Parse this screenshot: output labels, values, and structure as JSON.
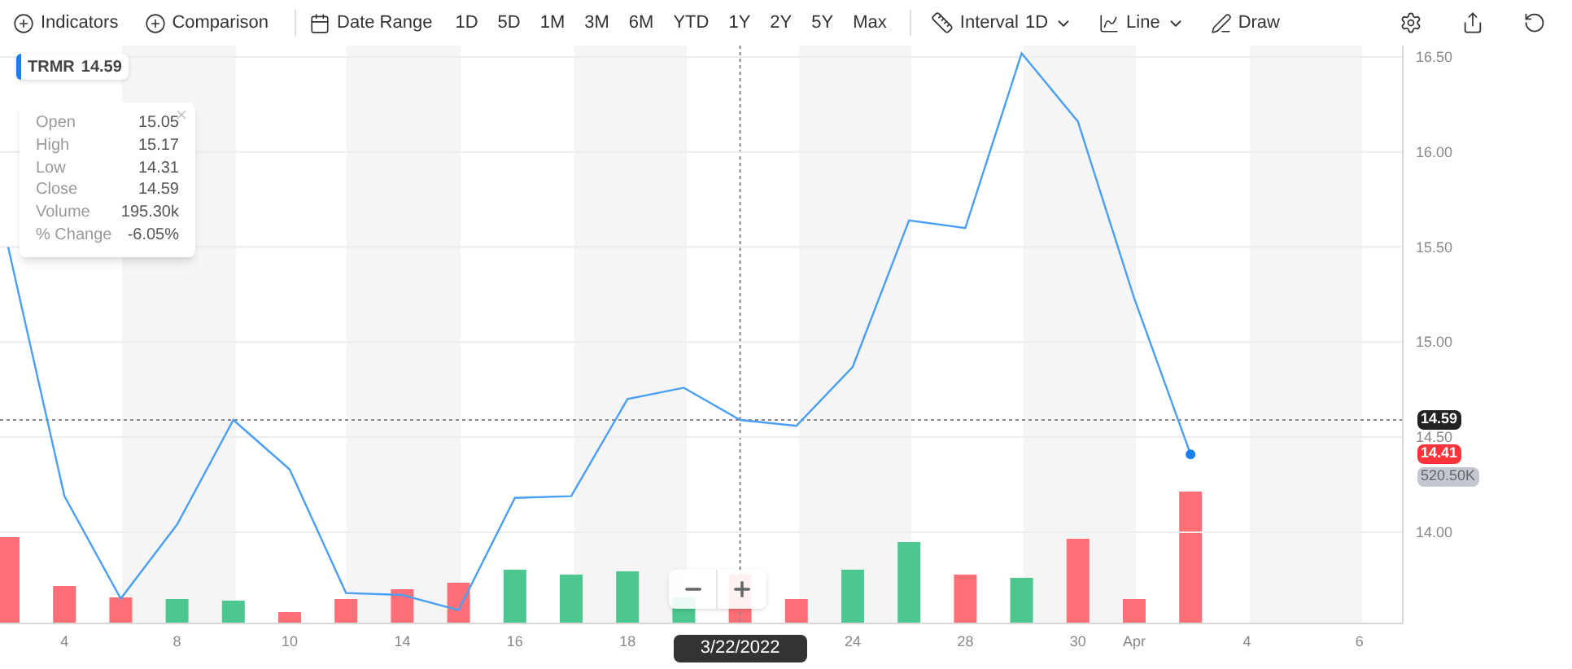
{
  "toolbar": {
    "add_buttons": [
      {
        "label": "Indicators"
      },
      {
        "label": "Comparison"
      }
    ],
    "date_range": {
      "label": "Date Range",
      "ranges": [
        "1D",
        "5D",
        "1M",
        "3M",
        "6M",
        "YTD",
        "1Y",
        "2Y",
        "5Y",
        "Max"
      ]
    },
    "interval": {
      "label": "Interval",
      "value": "1D"
    },
    "chart_type": {
      "label": "Line"
    },
    "draw": {
      "label": "Draw"
    }
  },
  "legend": {
    "price": "14.59"
  },
  "tooltip": {
    "rows": [
      {
        "label": "Open",
        "value": "15.05"
      },
      {
        "label": "High",
        "value": "15.17"
      },
      {
        "label": "Low",
        "value": "14.31"
      },
      {
        "label": "Close",
        "value": "14.59"
      },
      {
        "label": "Volume",
        "value": "195.30k"
      },
      {
        "label": "% Change",
        "value": "-6.05%"
      }
    ]
  },
  "chart_data": {
    "type": "line",
    "categories": [
      null,
      "4",
      null,
      "8",
      null,
      "10",
      null,
      "14",
      null,
      "16",
      null,
      "18",
      null,
      null,
      null,
      "24",
      null,
      "28",
      null,
      "30",
      "Apr",
      null,
      "4",
      null,
      "6"
    ],
    "series": [
      {
        "name": "TRMR",
        "color": "#4a9ff5",
        "values": [
          15.5,
          14.19,
          13.65,
          14.04,
          14.59,
          14.33,
          13.68,
          13.67,
          13.59,
          14.18,
          14.19,
          14.7,
          14.76,
          14.59,
          14.56,
          14.87,
          15.64,
          15.6,
          16.52,
          16.16,
          15.23,
          14.41,
          null,
          null,
          null
        ]
      }
    ],
    "ylim": [
      13.52,
      16.56
    ],
    "grid": true,
    "yticks": [
      {
        "value": 14,
        "label": "14.00"
      },
      {
        "value": 14.5,
        "label": "14.50"
      },
      {
        "value": 15,
        "label": "15.00"
      },
      {
        "value": 15.5,
        "label": "15.50"
      },
      {
        "value": 16,
        "label": "16.00"
      },
      {
        "value": 16.5,
        "label": "16.50"
      }
    ]
  },
  "crosshair": {
    "date": "3/22/2022",
    "price": "14.59"
  },
  "last_price": "14.41",
  "last_volume": "520.50K"
}
